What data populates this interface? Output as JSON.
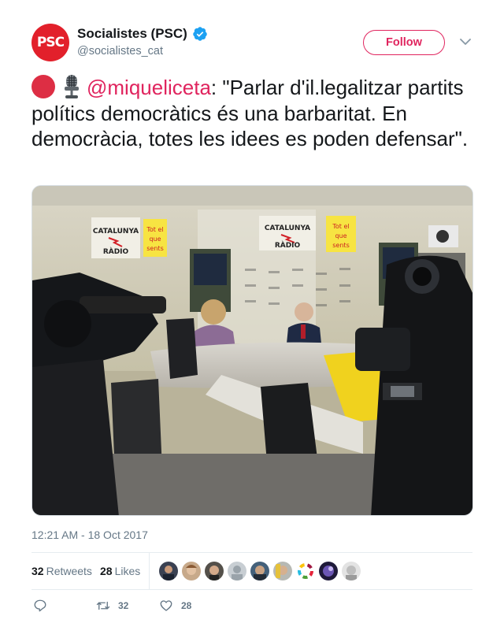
{
  "account": {
    "avatar_text": "PSC",
    "display_name": "Socialistes (PSC)",
    "handle": "@socialistes_cat",
    "verified_icon": "verified-badge-icon"
  },
  "header": {
    "follow_label": "Follow",
    "menu_icon": "chevron-down-icon"
  },
  "tweet": {
    "emoji_1": "red-circle-emoji",
    "emoji_2": "studio-microphone-emoji",
    "mention": "@miqueliceta",
    "text": ": \"Parlar d'il.legalitzar partits polítics democràtics és una barbaritat. En democràcia, totes les idees es poden defensar\".",
    "timestamp": "12:21 AM - 18 Oct 2017"
  },
  "media": {
    "description_icon": "radio-studio-photo",
    "signs": [
      "CATALUNYA RÀDIO",
      "Tot el que sents"
    ]
  },
  "stats": {
    "retweets_count": "32",
    "retweets_label": "Retweets",
    "likes_count": "28",
    "likes_label": "Likes"
  },
  "actions": {
    "reply_icon": "reply-icon",
    "retweet_icon": "retweet-icon",
    "retweet_count": "32",
    "like_icon": "heart-icon",
    "like_count": "28"
  },
  "colors": {
    "brand_red": "#e2202b",
    "accent_pink": "#e0245e",
    "verified_blue": "#1da1f2",
    "muted": "#657786"
  }
}
